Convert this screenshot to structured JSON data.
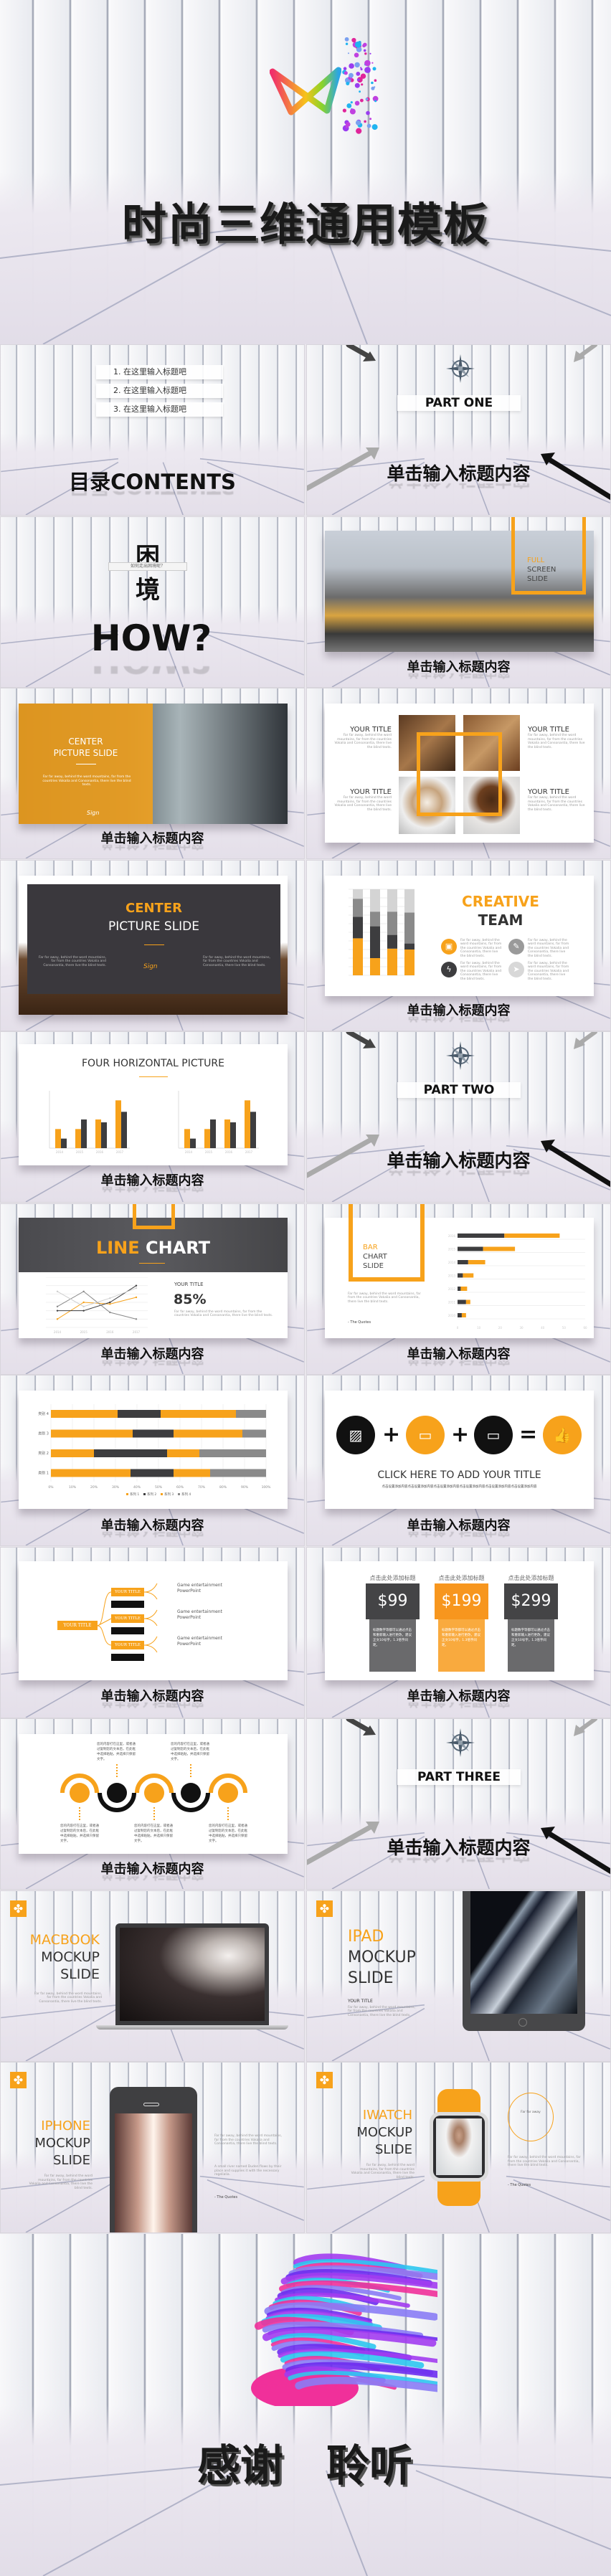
{
  "colors": {
    "accent": "#f7a21b",
    "dark": "#3d3d3f",
    "gray": "#8a8a8a",
    "light": "#d4d4d4"
  },
  "cover": {
    "title": "时尚三维通用模板",
    "logo": "colorful-ribbon-logo"
  },
  "contents": {
    "items": [
      "1. 在这里输入标题吧",
      "2. 在这里输入标题吧",
      "3. 在这里输入标题吧"
    ],
    "title": "目录CONTENTS"
  },
  "caption": "单击输入标题内容",
  "parts": [
    "PART ONE",
    "PART TWO",
    "PART THREE"
  ],
  "dilemma": {
    "top": "困",
    "ribbon": "如何走出困境呢？",
    "bottom": "境",
    "how": "HOW?"
  },
  "full_screen": {
    "l1": "FULL",
    "l2": "SCREEN",
    "l3": "SLIDE"
  },
  "center_pic": {
    "l1": "CENTER",
    "l2": "PICTURE SLIDE"
  },
  "lorem": "Far far away, behind the word mountains, far from the countries Vokalia and Consonantia, there live the blind texts.",
  "lorem_lead": "Far far away",
  "sign": "Sign",
  "grid": {
    "title": "YOUR TITLE"
  },
  "center_dark": {
    "l1": "CENTER",
    "l2": "PICTURE SLIDE"
  },
  "creative": {
    "l1": "CREATIVE",
    "l2": "TEAM",
    "icons": [
      "calendar-icon",
      "pen-icon",
      "lightning-icon",
      "paper-plane-icon"
    ]
  },
  "four_h": {
    "title": "FOUR HORIZONTAL PICTURE"
  },
  "line_chart": {
    "l1": "LINE",
    "l2": "CHART",
    "your_title": "YOUR TITLE",
    "percent": "85%"
  },
  "bar_slide": {
    "l1": "BAR",
    "l2": "CHART",
    "l3": "SLIDE",
    "quote": "- The Quotes"
  },
  "equation": {
    "title": "CLICK HERE TO ADD YOUR TITLE",
    "sub": "点击设置添加内容点击设置添加内容点击设置添加内容点击设置添加内容点击设置添加内容点击设置添加内容",
    "icons": [
      "picture-icon",
      "tv-icon",
      "monitor-icon",
      "thumbs-up-icon"
    ]
  },
  "mindmap": {
    "root": "YOUR TITLE",
    "branch": "YOUR TITLE",
    "text1": "Game entertainment",
    "text2": "PowerPoint"
  },
  "pricing": {
    "heading": "点击此处添加标题",
    "prices": [
      "$99",
      "$199",
      "$299"
    ],
    "desc": "标题数字等都可以通过点击和重新输入进行更改，建议正文10号字，1.3倍字间距。"
  },
  "timeline": {
    "text": "您的内容打在这里，或者通过复制您的文本后，在此框中选择粘贴，并选择只保留文字。",
    "icons": [
      "tv-icon",
      "lightbulb-icon",
      "basketball-icon",
      "trophy-icon",
      "location-icon"
    ]
  },
  "macbook": {
    "l1": "MACBOOK",
    "l2": "MOCKUP",
    "l3": "SLIDE"
  },
  "ipad": {
    "l1": "IPAD",
    "l2": "MOCKUP",
    "l3": "SLIDE",
    "your_title": "YOUR TITLE"
  },
  "iphone": {
    "l1": "IPHONE",
    "l2": "MOCKUP",
    "l3": "SLIDE",
    "text2": "A small river named Duden flows by their place and supplies it with the necessary regelialia.",
    "quote": "- The Quotes"
  },
  "iwatch": {
    "l1": "IWATCH",
    "l2": "MOCKUP",
    "l3": "SLIDE",
    "quote": "- The Quotes"
  },
  "thanks": {
    "w1": "感谢",
    "w2": "聆听"
  },
  "chart_data": [
    {
      "type": "bar",
      "stacked": true,
      "percent": true,
      "categories": [
        "1",
        "2",
        "3",
        "4"
      ],
      "series": [
        {
          "values": [
            43,
            20,
            31,
            30
          ],
          "color": "#f7a21b"
        },
        {
          "values": [
            25,
            37,
            16,
            7
          ],
          "color": "#3d3d3f"
        },
        {
          "values": [
            21,
            17,
            27,
            36
          ],
          "color": "#8a8a8a"
        },
        {
          "values": [
            11,
            26,
            26,
            27
          ],
          "color": "#d4d4d4"
        }
      ],
      "ylim": [
        0,
        100
      ]
    },
    {
      "type": "bar",
      "categories": [
        "2014",
        "2015",
        "2016",
        "2017"
      ],
      "series": [
        {
          "values": [
            2,
            2,
            3,
            5
          ],
          "color": "#f7a21b"
        },
        {
          "values": [
            1,
            3,
            2.7,
            3.8
          ],
          "color": "#3d3d3f"
        }
      ],
      "ylim": [
        0,
        6
      ]
    },
    {
      "type": "line",
      "x": [
        "2014",
        "2015",
        "2016",
        "2017"
      ],
      "series": [
        {
          "values": [
            1,
            3,
            2.8,
            3.6
          ],
          "color": "#f7a21b"
        },
        {
          "values": [
            2,
            2,
            3,
            5
          ],
          "color": "#3d3d3f"
        },
        {
          "values": [
            2.5,
            4.3,
            1.8,
            1
          ],
          "color": "#8a8a8a"
        },
        {
          "values": [
            4.3,
            2.5,
            3.5,
            4.7
          ],
          "color": "#cfcfcf"
        }
      ],
      "ylim": [
        0,
        6
      ]
    },
    {
      "type": "bar",
      "orientation": "horizontal",
      "stacked": true,
      "categories": [
        "2016",
        "2015",
        "2014",
        "2013",
        "2012",
        "2011",
        "2010"
      ],
      "series": [
        {
          "values": [
            22,
            12,
            5,
            2.5,
            1.5,
            4,
            2
          ],
          "color": "#3d3d3f"
        },
        {
          "values": [
            26,
            15,
            8,
            5,
            3,
            2,
            2
          ],
          "color": "#f7a21b"
        }
      ],
      "xlim": [
        0,
        60
      ]
    },
    {
      "type": "bar",
      "orientation": "horizontal",
      "stacked": true,
      "percent": true,
      "categories": [
        "类别 4",
        "类别 3",
        "类别 2",
        "类别 1"
      ],
      "series": [
        {
          "name": "系列 1",
          "values": [
            31,
            38,
            20,
            37
          ],
          "color": "#f7a21b"
        },
        {
          "name": "系列 2",
          "values": [
            20,
            19,
            34,
            20
          ],
          "color": "#3d3d3f"
        },
        {
          "name": "系列 3",
          "values": [
            35,
            32,
            15,
            17
          ],
          "color": "#f7a21b"
        },
        {
          "name": "系列 4",
          "values": [
            14,
            11,
            31,
            26
          ],
          "color": "#8a8a8a"
        }
      ],
      "xticks": [
        "0%",
        "10%",
        "20%",
        "30%",
        "40%",
        "50%",
        "60%",
        "70%",
        "80%",
        "90%",
        "100%"
      ],
      "legend": "bottom"
    }
  ]
}
